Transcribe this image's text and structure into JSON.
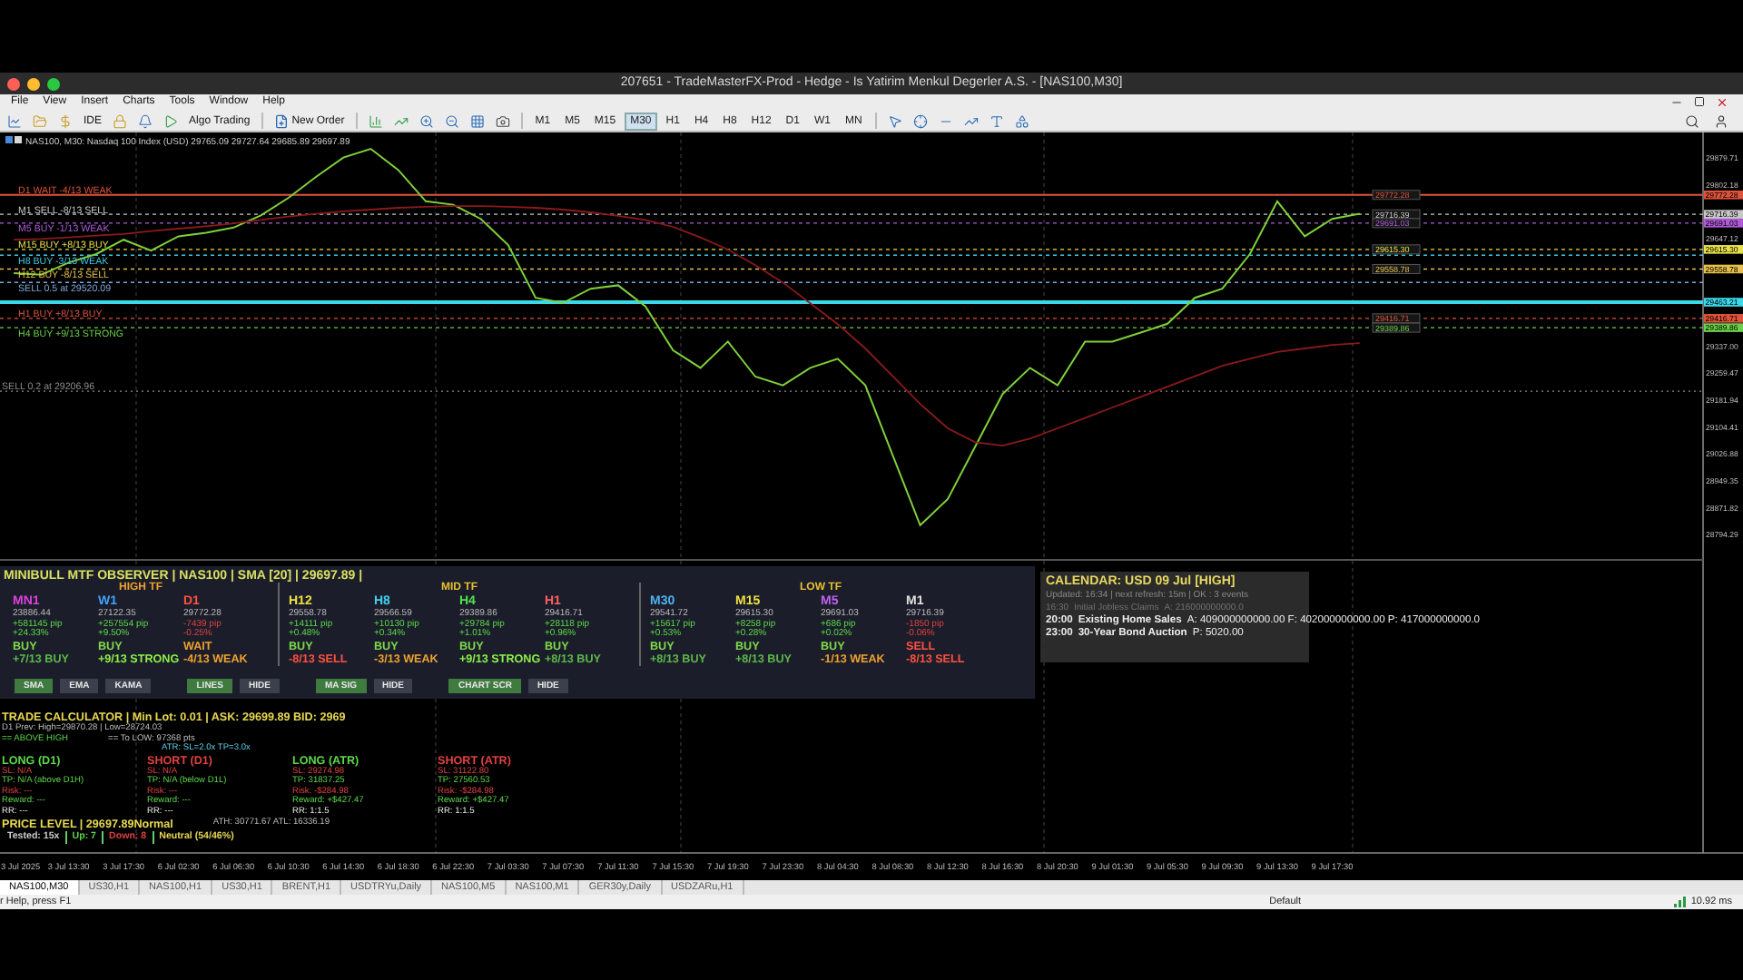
{
  "window": {
    "title": "207651 - TradeMasterFX-Prod - Hedge - Is Yatirim Menkul Degerler A.S. - [NAS100,M30]"
  },
  "menu": [
    "File",
    "View",
    "Insert",
    "Charts",
    "Tools",
    "Window",
    "Help"
  ],
  "toolbar": {
    "ide": "IDE",
    "algo": "Algo Trading",
    "order": "New Order",
    "timeframes": [
      {
        "label": "M1",
        "selected": false
      },
      {
        "label": "M5",
        "selected": false
      },
      {
        "label": "M15",
        "selected": false
      },
      {
        "label": "M30",
        "selected": true
      },
      {
        "label": "H1",
        "selected": false
      },
      {
        "label": "H4",
        "selected": false
      },
      {
        "label": "H8",
        "selected": false
      },
      {
        "label": "H12",
        "selected": false
      },
      {
        "label": "D1",
        "selected": false
      },
      {
        "label": "W1",
        "selected": false
      },
      {
        "label": "MN",
        "selected": false
      }
    ]
  },
  "chart": {
    "header": "NAS100, M30:  Nasdaq 100 Index (USD)  29765.09 29727.64 29685.89 29697.89",
    "levels": [
      {
        "text": "D1 WAIT -4/13 WEAK",
        "chart_tag": "29772.28",
        "kind": "solid"
      },
      {
        "text": "M1 SELL -8/13 SELL",
        "chart_tag": "29716.39",
        "kind": "dashed"
      },
      {
        "text": "M5 BUY -1/13 WEAK",
        "chart_tag": "29691.03",
        "kind": "dashed"
      },
      {
        "text": "M15 BUY +8/13 BUY",
        "chart_tag": "29615.30",
        "kind": "dashed"
      },
      {
        "text": "H8 BUY -3/13 WEAK",
        "kind": "dashed"
      },
      {
        "text": "H12 BUY -8/13 SELL",
        "chart_tag": "29558.78",
        "kind": "dashed"
      },
      {
        "text": "SELL 0.5 at 29520.09",
        "kind": "dashed"
      },
      {
        "kind": "thick"
      },
      {
        "text": "H1 BUY +8/13 BUY",
        "chart_tag": "29416.71",
        "kind": "dashed"
      },
      {
        "text": "H4 BUY +9/13 STRONG",
        "chart_tag": "29389.86",
        "kind": "dashed"
      },
      {
        "text": "SELL 0.2 at 29206.96",
        "kind": "dotted"
      }
    ],
    "chart_data": {
      "type": "line",
      "grid": true,
      "ylim": [
        27877,
        29952
      ],
      "categories": [
        "3 Jul 2025",
        null,
        "3 Jul 13:30",
        null,
        "3 Jul 17:30",
        null,
        "6 Jul 02:30",
        null,
        "6 Jul 06:30",
        null,
        "6 Jul 10:30",
        null,
        "6 Jul 14:30",
        null,
        "6 Jul 18:30",
        null,
        "6 Jul 22:30",
        null,
        "7 Jul 03:30",
        null,
        "7 Jul 07:30",
        null,
        "7 Jul 11:30",
        null,
        "7 Jul 15:30",
        null,
        "7 Jul 19:30",
        null,
        "7 Jul 23:30",
        null,
        "8 Jul 04:30",
        null,
        "8 Jul 08:30",
        null,
        "8 Jul 12:30",
        null,
        "8 Jul 16:30",
        null,
        "8 Jul 20:30",
        null,
        "9 Jul 01:30",
        null,
        "9 Jul 05:30",
        null,
        "9 Jul 09:30",
        null,
        "9 Jul 13:30",
        null,
        "9 Jul 17:30",
        null,
        null,
        null,
        null,
        null,
        null,
        null,
        null,
        null,
        null,
        null,
        null,
        null
      ],
      "yticks": [
        {
          "value": 29879.71,
          "label": "29879.71"
        },
        {
          "value": 29802.18,
          "label": "29802.18"
        },
        {
          "value": 29647.12,
          "label": "29647.12"
        },
        {
          "value": 29337.0,
          "label": "29337.00"
        },
        {
          "value": 29259.47,
          "label": "29259.47"
        },
        {
          "value": 29181.94,
          "label": "29181.94"
        },
        {
          "value": 29104.41,
          "label": "29104.41"
        },
        {
          "value": 29026.88,
          "label": "29026.88"
        },
        {
          "value": 28949.35,
          "label": "28949.35"
        },
        {
          "value": 28871.82,
          "label": "28871.82"
        },
        {
          "value": 28794.29,
          "label": "28794.29"
        }
      ],
      "ref_lines": [
        {
          "axis": "y",
          "value": 29772.28,
          "label": "29772.28",
          "color": "#e0523a"
        },
        {
          "axis": "y",
          "value": 29716.39,
          "label": "29716.39",
          "color": "#c8c8c8"
        },
        {
          "axis": "y",
          "value": 29691.03,
          "label": "29691.03",
          "color": "#b05ad8"
        },
        {
          "axis": "y",
          "value": 29615.3,
          "label": "29615.30",
          "color": "#e8e04a"
        },
        {
          "axis": "y",
          "value": 29598.59,
          "color": "#3ac8e0"
        },
        {
          "axis": "y",
          "value": 29558.78,
          "label": "29558.78",
          "color": "#e8c04a"
        },
        {
          "axis": "y",
          "value": 29520.09,
          "color": "#7aa7d8"
        },
        {
          "axis": "y",
          "value": 29463.21,
          "label": "29463.21",
          "color": "#3ad8e8"
        },
        {
          "axis": "y",
          "value": 29416.71,
          "label": "29416.71",
          "color": "#e0523a"
        },
        {
          "axis": "y",
          "value": 29389.86,
          "label": "29389.86",
          "color": "#6ad04a"
        },
        {
          "axis": "y",
          "value": 29206.96,
          "color": "#8a8a8a"
        }
      ],
      "series": [
        {
          "color": "#7fd03a",
          "values": [
            29547,
            29542,
            29577,
            29602,
            29643,
            29612,
            29653,
            29663,
            29678,
            29713,
            29764,
            29824,
            29880,
            29905,
            29844,
            29754,
            29744,
            29703,
            29628,
            29476,
            29461,
            29502,
            29512,
            29451,
            29325,
            29274,
            29350,
            29249,
            29224,
            29274,
            29300,
            29224,
            29022,
            28821,
            28896,
            29047,
            29199,
            29274,
            29224,
            29350,
            29350,
            29375,
            29401,
            29476,
            29502,
            29602,
            29754,
            29653,
            29703,
            29718,
            null,
            null,
            null,
            null,
            null,
            null,
            null,
            null,
            null,
            null,
            null,
            null
          ]
        },
        {
          "color": "#8b1a1a",
          "values": [
            29643,
            29645,
            29650,
            29655,
            29660,
            29668,
            29675,
            29682,
            29690,
            29700,
            29710,
            29718,
            29725,
            29730,
            29735,
            29738,
            29740,
            29740,
            29738,
            29735,
            29730,
            29722,
            29712,
            29700,
            29680,
            29650,
            29615,
            29570,
            29520,
            29460,
            29400,
            29330,
            29250,
            29170,
            29100,
            29060,
            29050,
            29070,
            29100,
            29130,
            29160,
            29190,
            29220,
            29250,
            29280,
            29300,
            29320,
            29330,
            29340,
            29345,
            null,
            null,
            null,
            null,
            null,
            null,
            null,
            null,
            null,
            null,
            null,
            null
          ]
        }
      ]
    }
  },
  "observer": {
    "title": "MINIBULL MTF OBSERVER  |  NAS100  |  SMA [20]  |  29697.89  |",
    "groups": [
      {
        "label": "HIGH TF",
        "color": "#f0a030",
        "columns": [
          {
            "name": "MN1",
            "color": "#e040e0",
            "price": "23886.44",
            "pips": "+581145 pip",
            "pct": "+24.33%",
            "up": true,
            "signal": {
              "text": "BUY",
              "kind": "buy"
            },
            "score": {
              "text": "+7/13 BUY",
              "kind": "buy"
            }
          },
          {
            "name": "W1",
            "color": "#40a0ff",
            "price": "27122.35",
            "pips": "+257554 pip",
            "pct": "+9.50%",
            "up": true,
            "signal": {
              "text": "BUY",
              "kind": "buy"
            },
            "score": {
              "text": "+9/13 STRONG",
              "kind": "strong"
            }
          },
          {
            "name": "D1",
            "color": "#ff5040",
            "price": "29772.28",
            "pips": "-7439 pip",
            "pct": "-0.25%",
            "up": false,
            "signal": {
              "text": "WAIT",
              "kind": "wait"
            },
            "score": {
              "text": "-4/13 WEAK",
              "kind": "weak"
            }
          }
        ]
      },
      {
        "label": "MID TF",
        "color": "#e8c030",
        "columns": [
          {
            "name": "H12",
            "color": "#f0e040",
            "price": "29558.78",
            "pips": "+14111 pip",
            "pct": "+0.48%",
            "up": true,
            "signal": {
              "text": "BUY",
              "kind": "buy"
            },
            "score": {
              "text": "-8/13 SELL",
              "kind": "sell"
            }
          },
          {
            "name": "H8",
            "color": "#40d0f0",
            "price": "29566.59",
            "pips": "+10130 pip",
            "pct": "+0.34%",
            "up": true,
            "signal": {
              "text": "BUY",
              "kind": "buy"
            },
            "score": {
              "text": "-3/13 WEAK",
              "kind": "weak"
            }
          },
          {
            "name": "H4",
            "color": "#50e050",
            "price": "29389.86",
            "pips": "+29784 pip",
            "pct": "+1.01%",
            "up": true,
            "signal": {
              "text": "BUY",
              "kind": "buy"
            },
            "score": {
              "text": "+9/13 STRONG",
              "kind": "strong"
            }
          },
          {
            "name": "H1",
            "color": "#ff6060",
            "price": "29416.71",
            "pips": "+28118 pip",
            "pct": "+0.96%",
            "up": true,
            "signal": {
              "text": "BUY",
              "kind": "buy"
            },
            "score": {
              "text": "+8/13 BUY",
              "kind": "buy"
            }
          }
        ]
      },
      {
        "label": "LOW TF",
        "color": "#e8c030",
        "columns": [
          {
            "name": "M30",
            "color": "#50b0f0",
            "price": "29541.72",
            "pips": "+15617 pip",
            "pct": "+0.53%",
            "up": true,
            "signal": {
              "text": "BUY",
              "kind": "buy"
            },
            "score": {
              "text": "+8/13 BUY",
              "kind": "buy"
            }
          },
          {
            "name": "M15",
            "color": "#f0e040",
            "price": "29615.30",
            "pips": "+8258 pip",
            "pct": "+0.28%",
            "up": true,
            "signal": {
              "text": "BUY",
              "kind": "buy"
            },
            "score": {
              "text": "+8/13 BUY",
              "kind": "buy"
            }
          },
          {
            "name": "M5",
            "color": "#c060f0",
            "price": "29691.03",
            "pips": "+686 pip",
            "pct": "+0.02%",
            "up": true,
            "signal": {
              "text": "BUY",
              "kind": "buy"
            },
            "score": {
              "text": "-1/13 WEAK",
              "kind": "weak"
            }
          },
          {
            "name": "M1",
            "color": "#e0e0e0",
            "price": "29716.39",
            "pips": "-1850 pip",
            "pct": "-0.06%",
            "up": false,
            "signal": {
              "text": "SELL",
              "kind": "sell"
            },
            "score": {
              "text": "-8/13 SELL",
              "kind": "sell"
            }
          }
        ]
      }
    ],
    "button_groups": [
      [
        {
          "label": "SMA",
          "on": true
        },
        {
          "label": "EMA",
          "on": false
        },
        {
          "label": "KAMA",
          "on": false
        }
      ],
      [
        {
          "label": "LINES",
          "on": true
        },
        {
          "label": "HIDE",
          "on": false
        }
      ],
      [
        {
          "label": "MA SIG",
          "on": true
        },
        {
          "label": "HIDE",
          "on": false
        }
      ],
      [
        {
          "label": "CHART SCR",
          "on": true
        },
        {
          "label": "HIDE",
          "on": false
        }
      ]
    ]
  },
  "calendar": {
    "title": "CALENDAR: USD  09 Jul  [HIGH]",
    "status": "Updated: 16:34 | next refresh: 15m | OK : 3 events",
    "events": [
      {
        "time": "16:30",
        "name": "Initial Jobless Claims",
        "values": "A: 216000000000.0",
        "past": true
      },
      {
        "time": "20:00",
        "name": "Existing Home Sales",
        "values": "A: 409000000000.00  F: 402000000000.00  P: 417000000000.0",
        "past": false
      },
      {
        "time": "23:00",
        "name": "30-Year Bond Auction",
        "values": "P: 5020.00",
        "past": false
      }
    ]
  },
  "calculator": {
    "title": "TRADE CALCULATOR  |  Min Lot: 0.01  |  ASK: 29699.89  BID: 2969",
    "prev": "D1 Prev: High=29870.28 | Low=28724.03",
    "above": "== ABOVE HIGH",
    "to_low": "== To LOW: 97368 pts",
    "atr": "ATR: SL=2.0x TP=3.0x",
    "columns": [
      {
        "title": "LONG (D1)",
        "kind": "long",
        "lines": [
          "SL: N/A",
          "TP: N/A (above D1H)",
          "Risk: ---",
          "Reward: ---",
          "RR: ---"
        ]
      },
      {
        "title": "SHORT (D1)",
        "kind": "short",
        "lines": [
          "SL: N/A",
          "TP: N/A (below D1L)",
          "Risk: ---",
          "Reward: ---",
          "RR: ---"
        ]
      },
      {
        "title": "LONG (ATR)",
        "kind": "long",
        "lines": [
          "SL: 29274.98",
          "TP: 31837.25",
          "Risk: -$284.98",
          "Reward: +$427.47",
          "RR: 1:1.5"
        ]
      },
      {
        "title": "SHORT (ATR)",
        "kind": "short",
        "lines": [
          "SL: 31122.80",
          "TP: 27560.53",
          "Risk: -$284.98",
          "Reward: +$427.47",
          "RR: 1:1.5"
        ]
      }
    ],
    "price_level": "PRICE LEVEL  |  29697.89Normal",
    "ath": "ATH: 30771.67    ATL: 16336.19",
    "tested": [
      {
        "text": "Tested: 15x",
        "kind": "plain"
      },
      {
        "text": "Up: 7",
        "kind": "up"
      },
      {
        "text": "Down: 8",
        "kind": "down"
      },
      {
        "text": "Neutral (54/46%)",
        "kind": "neutral"
      }
    ]
  },
  "tabs": [
    {
      "label": "NAS100,M30",
      "selected": true
    },
    {
      "label": "US30,H1",
      "selected": false
    },
    {
      "label": "NAS100,H1",
      "selected": false
    },
    {
      "label": "US30,H1",
      "selected": false
    },
    {
      "label": "BRENT,H1",
      "selected": false
    },
    {
      "label": "USDTRYu,Daily",
      "selected": false
    },
    {
      "label": "NAS100,M5",
      "selected": false
    },
    {
      "label": "NAS100,M1",
      "selected": false
    },
    {
      "label": "GER30y,Daily",
      "selected": false
    },
    {
      "label": "USDZARu,H1",
      "selected": false
    }
  ],
  "status_bar": {
    "help": "r Help, press F1",
    "profile": "Default",
    "ping": "10.92 ms"
  }
}
